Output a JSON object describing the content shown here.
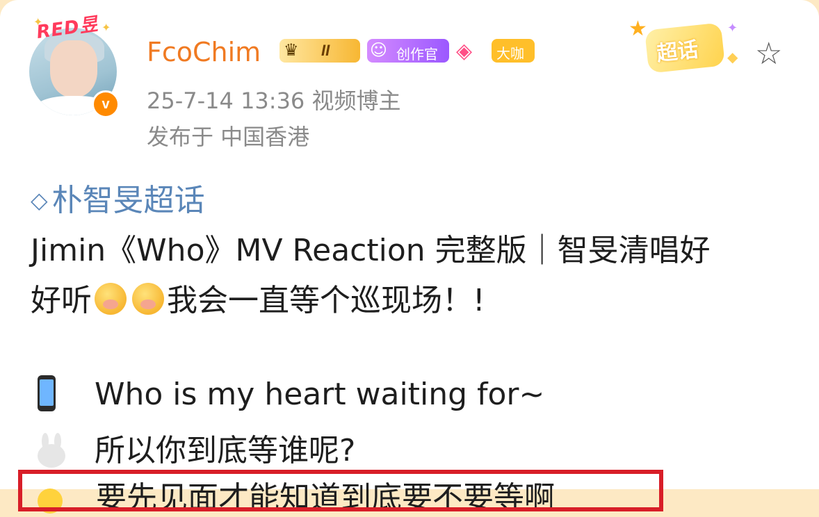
{
  "post": {
    "avatar_tag": "RED昱",
    "username": "FcoChim",
    "badges": {
      "crown_level": "II",
      "creator_label": "创作官",
      "bigshot_label": "大咖"
    },
    "timestamp_line": "25-7-14 13:36  视频博主",
    "location_line": "发布于 中国香港",
    "supertopic_badge": "超话",
    "topic": "朴智旻超话",
    "lines": {
      "line1": "Jimin《Who》MV Reaction 完整版｜智旻清唱好",
      "line2_start": "好听",
      "line2_end": "我会一直等个巡现场！!",
      "line3": "Who is my heart waiting for~",
      "line4": "所以你到底等谁呢?",
      "line5": "要先见面才能知道到底要不要等啊"
    }
  },
  "colors": {
    "username": "#f07a22",
    "topic": "#5a86b8",
    "meta": "#8a8a8a",
    "highlight_box": "#d81e28"
  },
  "icons": [
    "crown-icon",
    "creator-icon",
    "diamond-icon",
    "star-outline-icon",
    "verified-icon",
    "phone-emoji",
    "bunny-emoji",
    "chick-emoji",
    "pleading-emoji"
  ]
}
